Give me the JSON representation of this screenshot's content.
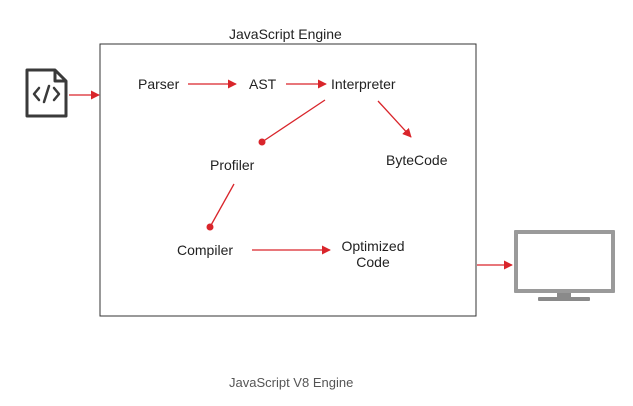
{
  "diagram": {
    "engine_title": "JavaScript Engine",
    "caption": "JavaScript V8 Engine",
    "nodes": {
      "parser": "Parser",
      "ast": "AST",
      "interpreter": "Interpreter",
      "bytecode": "ByteCode",
      "profiler": "Profiler",
      "compiler": "Compiler",
      "optimized_line1": "Optimized",
      "optimized_line2": "Code"
    },
    "icons": {
      "source": "code-file-icon",
      "output": "monitor-icon"
    },
    "colors": {
      "arrow": "#d9252b",
      "box_border": "#333333",
      "icon": "#3a3a3a",
      "monitor_frame": "#9a9a9a",
      "monitor_screen": "#ffffff"
    }
  }
}
